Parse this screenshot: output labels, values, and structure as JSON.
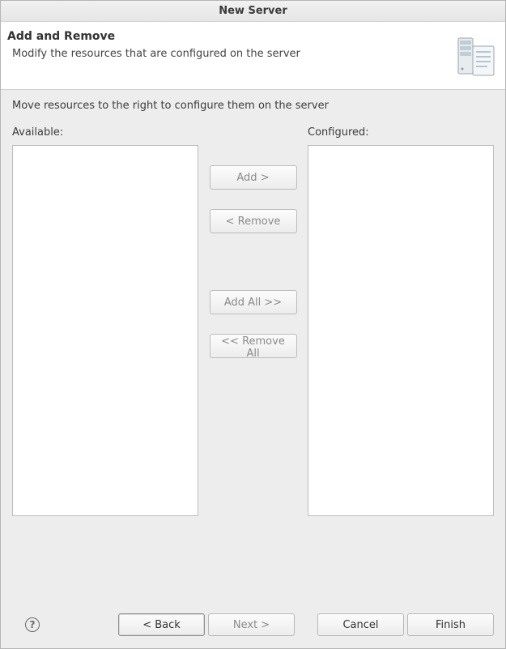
{
  "window": {
    "title": "New Server"
  },
  "banner": {
    "title": "Add and Remove",
    "description": "Modify the resources that are configured on the server"
  },
  "content": {
    "instruction": "Move resources to the right to configure them on the server",
    "available_label": "Available:",
    "configured_label": "Configured:",
    "available_items": [],
    "configured_items": [],
    "buttons": {
      "add": "Add >",
      "remove": "< Remove",
      "add_all": "Add All >>",
      "remove_all": "<< Remove All"
    }
  },
  "footer": {
    "back": "< Back",
    "next": "Next >",
    "cancel": "Cancel",
    "finish": "Finish"
  }
}
